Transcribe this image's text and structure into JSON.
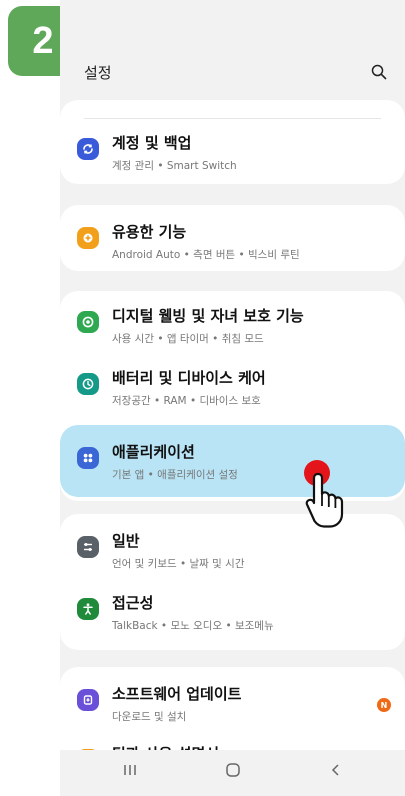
{
  "step": {
    "number": "2",
    "color": "#5fa85a"
  },
  "header": {
    "title": "설정",
    "search_icon": "search-icon"
  },
  "items": [
    {
      "id": "accounts",
      "label": "계정 및 백업",
      "sub": "계정 관리 • Smart Switch",
      "icon": "sync-icon",
      "color": "#3a5bd9"
    },
    {
      "id": "advanced",
      "label": "유용한 기능",
      "sub": "Android Auto • 측면 버튼 • 빅스비 루틴",
      "icon": "gear-plus-icon",
      "color": "#f2a01b"
    },
    {
      "id": "wellbeing",
      "label": "디지털 웰빙 및 자녀 보호 기능",
      "sub": "사용 시간 • 앱 타이머 • 취침 모드",
      "icon": "wellbeing-icon",
      "color": "#2ea851"
    },
    {
      "id": "battery",
      "label": "배터리 및 디바이스 케어",
      "sub": "저장공간 • RAM • 디바이스 보호",
      "icon": "device-care-icon",
      "color": "#159a8a"
    },
    {
      "id": "apps",
      "label": "애플리케이션",
      "sub": "기본 앱 • 애플리케이션 설정",
      "icon": "apps-grid-icon",
      "color": "#3a66d6",
      "highlighted": true
    },
    {
      "id": "general",
      "label": "일반",
      "sub": "언어 및 키보드 • 날짜 및 시간",
      "icon": "sliders-icon",
      "color": "#5a6068"
    },
    {
      "id": "accessibility",
      "label": "접근성",
      "sub": "TalkBack • 모노 오디오 • 보조메뉴",
      "icon": "accessibility-icon",
      "color": "#1f8a3a"
    },
    {
      "id": "update",
      "label": "소프트웨어 업데이트",
      "sub": "다운로드 및 설치",
      "icon": "update-icon",
      "color": "#6a4fd8",
      "badge": "N",
      "badge_color": "#ef6a15"
    },
    {
      "id": "manual",
      "label": "팁과 사용 설명서",
      "icon": "manual-icon",
      "color": "#f2a01b"
    }
  ],
  "navbar": {
    "recent": "recent-apps-icon",
    "home": "home-icon",
    "back": "back-icon"
  },
  "tap": {
    "color": "#e3151b",
    "pointer": "hand-pointer-icon"
  }
}
